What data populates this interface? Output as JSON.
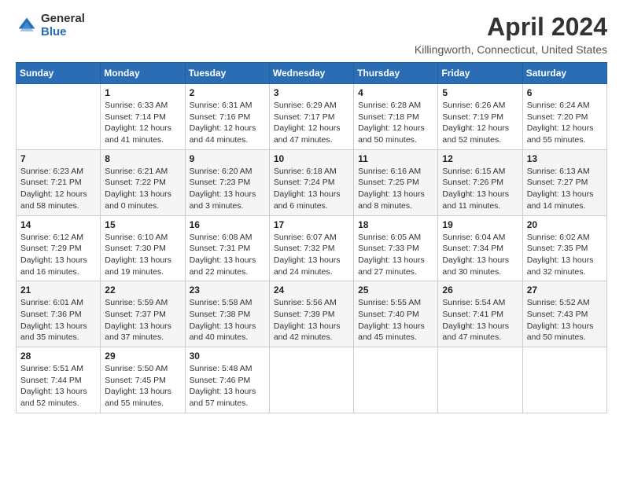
{
  "header": {
    "logo_general": "General",
    "logo_blue": "Blue",
    "title": "April 2024",
    "subtitle": "Killingworth, Connecticut, United States"
  },
  "weekdays": [
    "Sunday",
    "Monday",
    "Tuesday",
    "Wednesday",
    "Thursday",
    "Friday",
    "Saturday"
  ],
  "weeks": [
    [
      {
        "day": "",
        "sunrise": "",
        "sunset": "",
        "daylight": ""
      },
      {
        "day": "1",
        "sunrise": "Sunrise: 6:33 AM",
        "sunset": "Sunset: 7:14 PM",
        "daylight": "Daylight: 12 hours and 41 minutes."
      },
      {
        "day": "2",
        "sunrise": "Sunrise: 6:31 AM",
        "sunset": "Sunset: 7:16 PM",
        "daylight": "Daylight: 12 hours and 44 minutes."
      },
      {
        "day": "3",
        "sunrise": "Sunrise: 6:29 AM",
        "sunset": "Sunset: 7:17 PM",
        "daylight": "Daylight: 12 hours and 47 minutes."
      },
      {
        "day": "4",
        "sunrise": "Sunrise: 6:28 AM",
        "sunset": "Sunset: 7:18 PM",
        "daylight": "Daylight: 12 hours and 50 minutes."
      },
      {
        "day": "5",
        "sunrise": "Sunrise: 6:26 AM",
        "sunset": "Sunset: 7:19 PM",
        "daylight": "Daylight: 12 hours and 52 minutes."
      },
      {
        "day": "6",
        "sunrise": "Sunrise: 6:24 AM",
        "sunset": "Sunset: 7:20 PM",
        "daylight": "Daylight: 12 hours and 55 minutes."
      }
    ],
    [
      {
        "day": "7",
        "sunrise": "Sunrise: 6:23 AM",
        "sunset": "Sunset: 7:21 PM",
        "daylight": "Daylight: 12 hours and 58 minutes."
      },
      {
        "day": "8",
        "sunrise": "Sunrise: 6:21 AM",
        "sunset": "Sunset: 7:22 PM",
        "daylight": "Daylight: 13 hours and 0 minutes."
      },
      {
        "day": "9",
        "sunrise": "Sunrise: 6:20 AM",
        "sunset": "Sunset: 7:23 PM",
        "daylight": "Daylight: 13 hours and 3 minutes."
      },
      {
        "day": "10",
        "sunrise": "Sunrise: 6:18 AM",
        "sunset": "Sunset: 7:24 PM",
        "daylight": "Daylight: 13 hours and 6 minutes."
      },
      {
        "day": "11",
        "sunrise": "Sunrise: 6:16 AM",
        "sunset": "Sunset: 7:25 PM",
        "daylight": "Daylight: 13 hours and 8 minutes."
      },
      {
        "day": "12",
        "sunrise": "Sunrise: 6:15 AM",
        "sunset": "Sunset: 7:26 PM",
        "daylight": "Daylight: 13 hours and 11 minutes."
      },
      {
        "day": "13",
        "sunrise": "Sunrise: 6:13 AM",
        "sunset": "Sunset: 7:27 PM",
        "daylight": "Daylight: 13 hours and 14 minutes."
      }
    ],
    [
      {
        "day": "14",
        "sunrise": "Sunrise: 6:12 AM",
        "sunset": "Sunset: 7:29 PM",
        "daylight": "Daylight: 13 hours and 16 minutes."
      },
      {
        "day": "15",
        "sunrise": "Sunrise: 6:10 AM",
        "sunset": "Sunset: 7:30 PM",
        "daylight": "Daylight: 13 hours and 19 minutes."
      },
      {
        "day": "16",
        "sunrise": "Sunrise: 6:08 AM",
        "sunset": "Sunset: 7:31 PM",
        "daylight": "Daylight: 13 hours and 22 minutes."
      },
      {
        "day": "17",
        "sunrise": "Sunrise: 6:07 AM",
        "sunset": "Sunset: 7:32 PM",
        "daylight": "Daylight: 13 hours and 24 minutes."
      },
      {
        "day": "18",
        "sunrise": "Sunrise: 6:05 AM",
        "sunset": "Sunset: 7:33 PM",
        "daylight": "Daylight: 13 hours and 27 minutes."
      },
      {
        "day": "19",
        "sunrise": "Sunrise: 6:04 AM",
        "sunset": "Sunset: 7:34 PM",
        "daylight": "Daylight: 13 hours and 30 minutes."
      },
      {
        "day": "20",
        "sunrise": "Sunrise: 6:02 AM",
        "sunset": "Sunset: 7:35 PM",
        "daylight": "Daylight: 13 hours and 32 minutes."
      }
    ],
    [
      {
        "day": "21",
        "sunrise": "Sunrise: 6:01 AM",
        "sunset": "Sunset: 7:36 PM",
        "daylight": "Daylight: 13 hours and 35 minutes."
      },
      {
        "day": "22",
        "sunrise": "Sunrise: 5:59 AM",
        "sunset": "Sunset: 7:37 PM",
        "daylight": "Daylight: 13 hours and 37 minutes."
      },
      {
        "day": "23",
        "sunrise": "Sunrise: 5:58 AM",
        "sunset": "Sunset: 7:38 PM",
        "daylight": "Daylight: 13 hours and 40 minutes."
      },
      {
        "day": "24",
        "sunrise": "Sunrise: 5:56 AM",
        "sunset": "Sunset: 7:39 PM",
        "daylight": "Daylight: 13 hours and 42 minutes."
      },
      {
        "day": "25",
        "sunrise": "Sunrise: 5:55 AM",
        "sunset": "Sunset: 7:40 PM",
        "daylight": "Daylight: 13 hours and 45 minutes."
      },
      {
        "day": "26",
        "sunrise": "Sunrise: 5:54 AM",
        "sunset": "Sunset: 7:41 PM",
        "daylight": "Daylight: 13 hours and 47 minutes."
      },
      {
        "day": "27",
        "sunrise": "Sunrise: 5:52 AM",
        "sunset": "Sunset: 7:43 PM",
        "daylight": "Daylight: 13 hours and 50 minutes."
      }
    ],
    [
      {
        "day": "28",
        "sunrise": "Sunrise: 5:51 AM",
        "sunset": "Sunset: 7:44 PM",
        "daylight": "Daylight: 13 hours and 52 minutes."
      },
      {
        "day": "29",
        "sunrise": "Sunrise: 5:50 AM",
        "sunset": "Sunset: 7:45 PM",
        "daylight": "Daylight: 13 hours and 55 minutes."
      },
      {
        "day": "30",
        "sunrise": "Sunrise: 5:48 AM",
        "sunset": "Sunset: 7:46 PM",
        "daylight": "Daylight: 13 hours and 57 minutes."
      },
      {
        "day": "",
        "sunrise": "",
        "sunset": "",
        "daylight": ""
      },
      {
        "day": "",
        "sunrise": "",
        "sunset": "",
        "daylight": ""
      },
      {
        "day": "",
        "sunrise": "",
        "sunset": "",
        "daylight": ""
      },
      {
        "day": "",
        "sunrise": "",
        "sunset": "",
        "daylight": ""
      }
    ]
  ]
}
